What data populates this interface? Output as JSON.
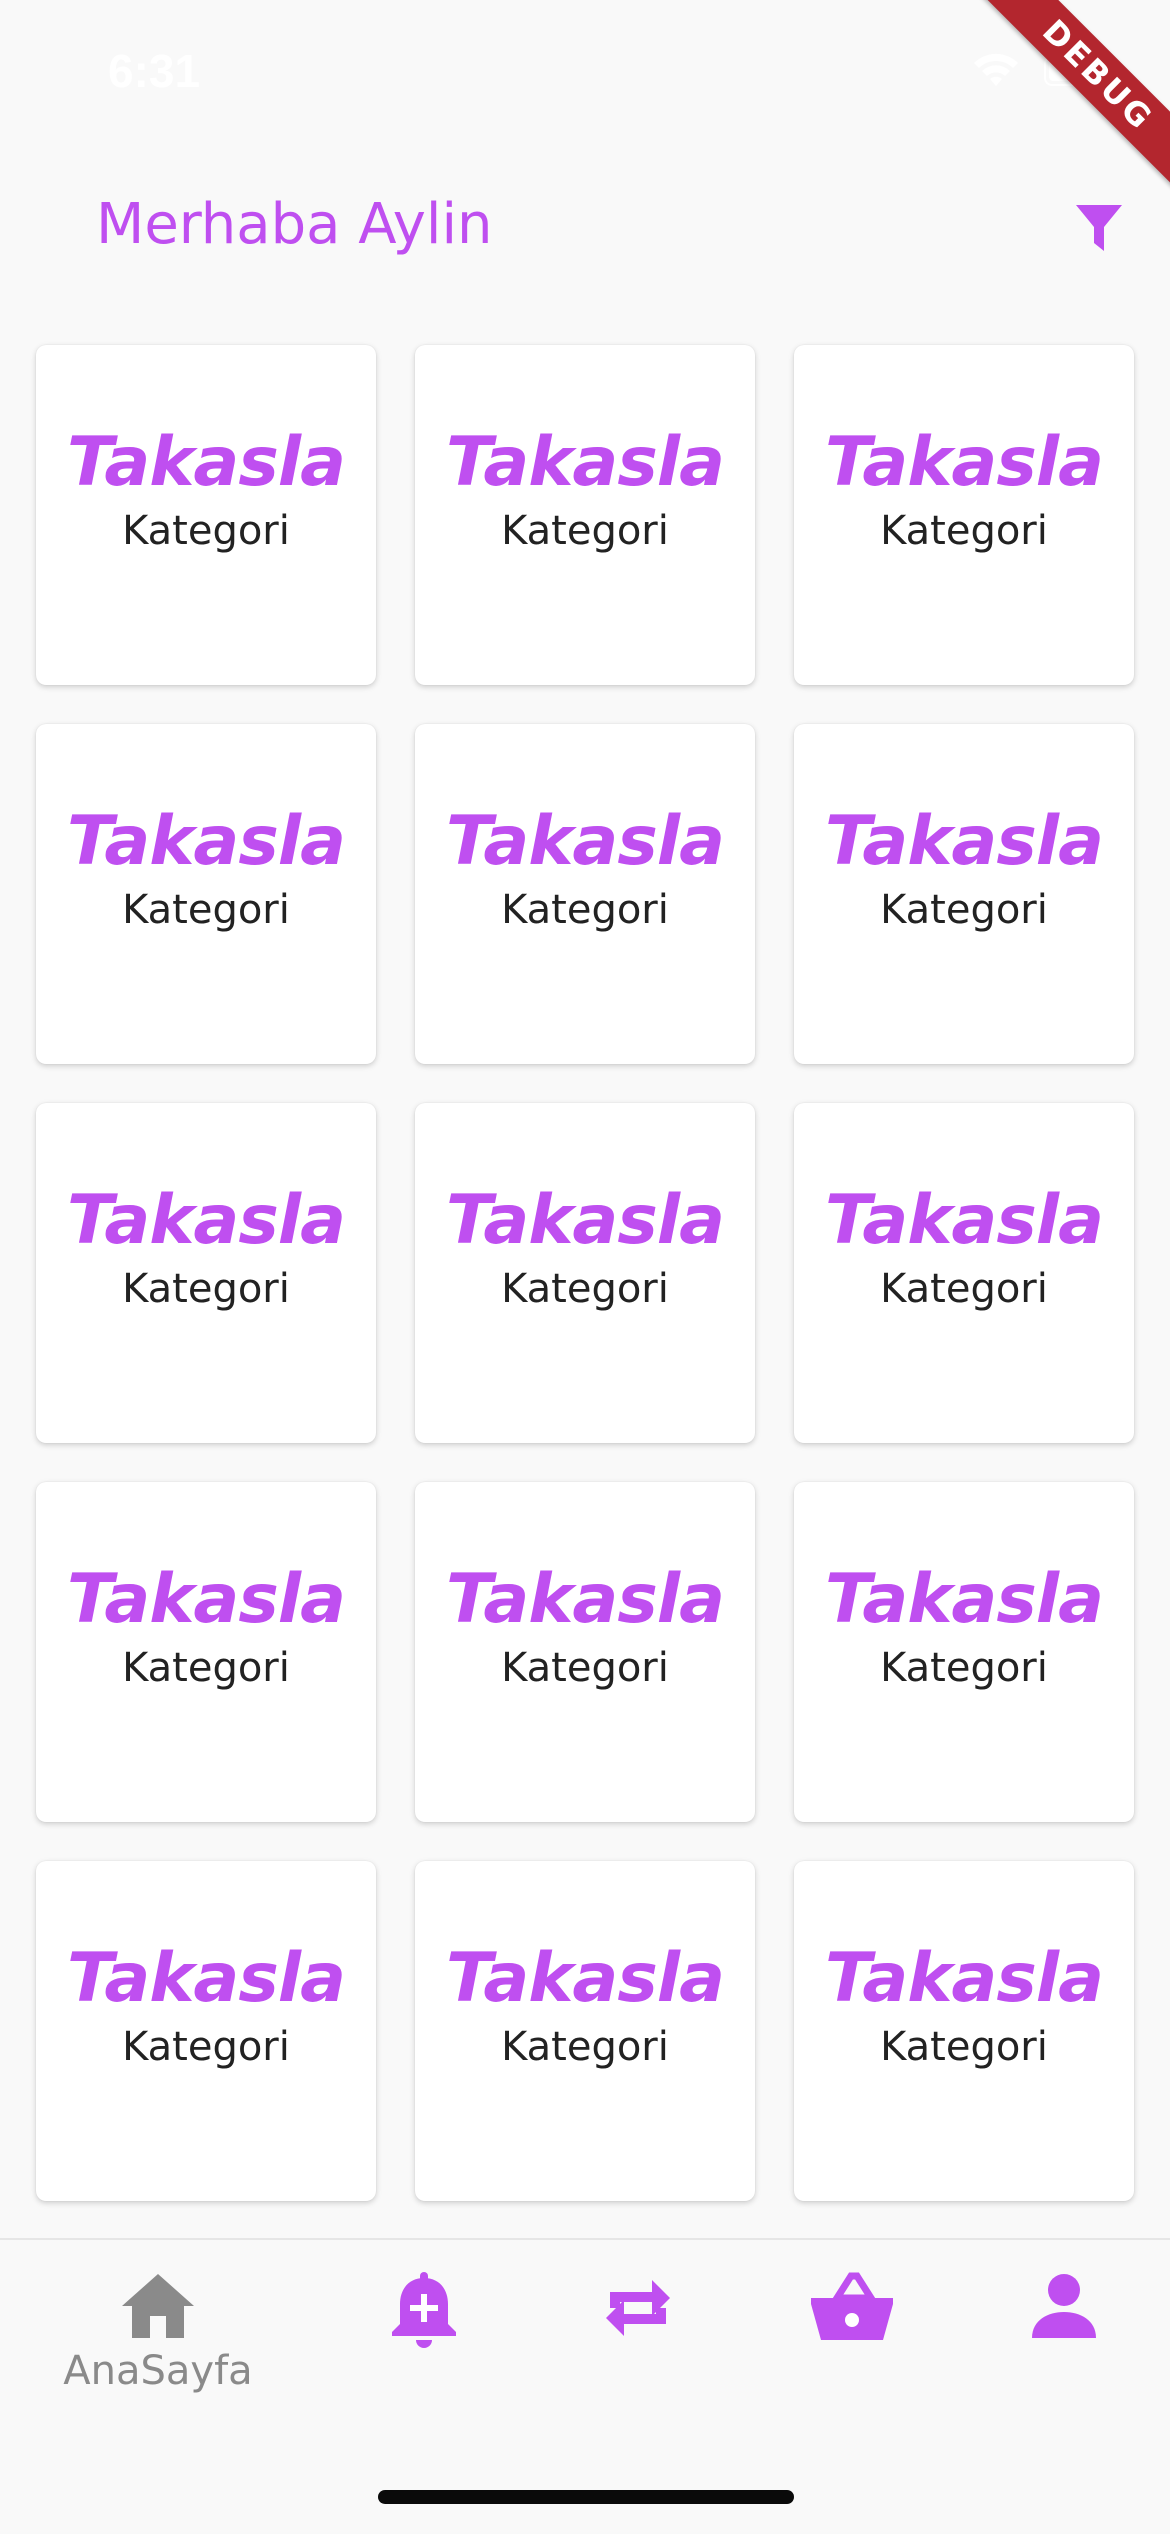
{
  "status_bar": {
    "time": "6:31"
  },
  "debug_banner": "DEBUG",
  "header": {
    "greeting": "Merhaba Aylin",
    "filter_icon": "filter-icon"
  },
  "colors": {
    "accent": "#bf4ff0",
    "text": "#222222",
    "muted": "#8a8a8a",
    "background": "#f9f9f9",
    "card": "#ffffff"
  },
  "categories": [
    {
      "logo": "Takasla",
      "label": "Kategori"
    },
    {
      "logo": "Takasla",
      "label": "Kategori"
    },
    {
      "logo": "Takasla",
      "label": "Kategori"
    },
    {
      "logo": "Takasla",
      "label": "Kategori"
    },
    {
      "logo": "Takasla",
      "label": "Kategori"
    },
    {
      "logo": "Takasla",
      "label": "Kategori"
    },
    {
      "logo": "Takasla",
      "label": "Kategori"
    },
    {
      "logo": "Takasla",
      "label": "Kategori"
    },
    {
      "logo": "Takasla",
      "label": "Kategori"
    },
    {
      "logo": "Takasla",
      "label": "Kategori"
    },
    {
      "logo": "Takasla",
      "label": "Kategori"
    },
    {
      "logo": "Takasla",
      "label": "Kategori"
    },
    {
      "logo": "Takasla",
      "label": "Kategori"
    },
    {
      "logo": "Takasla",
      "label": "Kategori"
    },
    {
      "logo": "Takasla",
      "label": "Kategori"
    }
  ],
  "bottom_nav": {
    "items": [
      {
        "icon": "home-icon",
        "label": "AnaSayfa",
        "active": true
      },
      {
        "icon": "bell-plus-icon",
        "label": "",
        "active": false
      },
      {
        "icon": "swap-icon",
        "label": "",
        "active": false
      },
      {
        "icon": "basket-icon",
        "label": "",
        "active": false
      },
      {
        "icon": "person-icon",
        "label": "",
        "active": false
      }
    ]
  }
}
